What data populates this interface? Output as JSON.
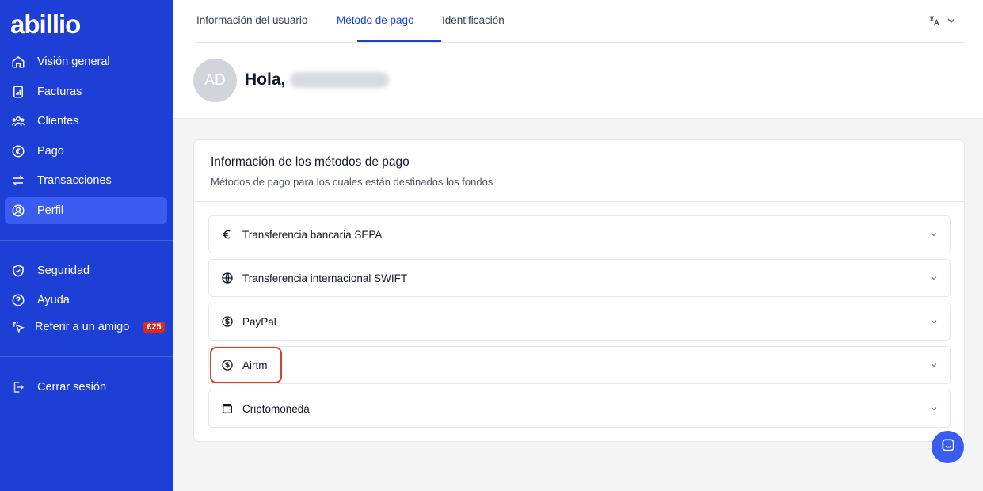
{
  "app": {
    "logo": "abillio"
  },
  "sidebar": {
    "items": [
      {
        "label": "Visión general",
        "icon": "home-icon"
      },
      {
        "label": "Facturas",
        "icon": "invoice-icon"
      },
      {
        "label": "Clientes",
        "icon": "users-icon"
      },
      {
        "label": "Pago",
        "icon": "euro-circle-icon"
      },
      {
        "label": "Transacciones",
        "icon": "arrows-exchange-icon"
      },
      {
        "label": "Perfil",
        "icon": "user-circle-icon",
        "active": true
      }
    ],
    "secondary": [
      {
        "label": "Seguridad",
        "icon": "shield-icon"
      },
      {
        "label": "Ayuda",
        "icon": "help-circle-icon"
      },
      {
        "label": "Referir a un amigo",
        "icon": "click-icon",
        "badge": "€25"
      }
    ],
    "logout": {
      "label": "Cerrar sesión",
      "icon": "logout-icon"
    }
  },
  "tabs": [
    {
      "label": "Información del usuario"
    },
    {
      "label": "Método de pago",
      "active": true
    },
    {
      "label": "Identificación"
    }
  ],
  "language": {
    "icon": "translate-icon"
  },
  "profile": {
    "initials": "AD",
    "greeting": "Hola,"
  },
  "payment": {
    "title": "Información de los métodos de pago",
    "subtitle": "Métodos de pago para los cuales están destinados los fondos",
    "methods": [
      {
        "label": "Transferencia bancaria SEPA",
        "icon": "euro-icon"
      },
      {
        "label": "Transferencia internacional SWIFT",
        "icon": "globe-icon"
      },
      {
        "label": "PayPal",
        "icon": "dollar-circle-icon"
      },
      {
        "label": "Airtm",
        "icon": "dollar-circle-icon",
        "highlighted": true
      },
      {
        "label": "Criptomoneda",
        "icon": "wallet-icon"
      }
    ]
  },
  "colors": {
    "sidebar": "#1d3fd6",
    "active_item": "#3a5cf0",
    "highlight": "#d0442f",
    "badge": "#e0281d"
  }
}
